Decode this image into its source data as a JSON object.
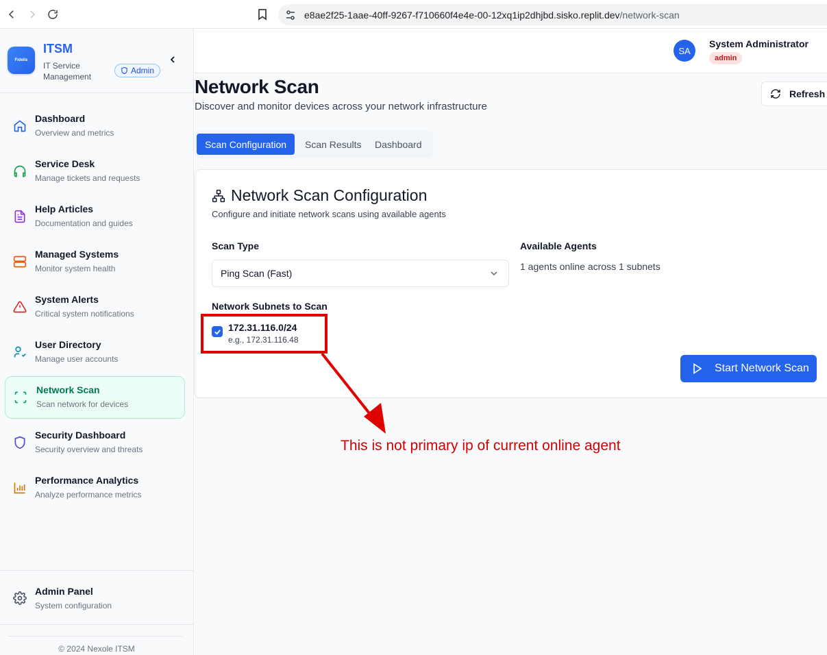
{
  "browser": {
    "url_host": "e8ae2f25-1aae-40ff-9267-f710660f4e4e-00-12xq1ip2dhjbd.sisko.replit.dev",
    "url_path": "/network-scan"
  },
  "brand": {
    "logo_text": "Fidelis",
    "title": "ITSM",
    "subtitle": "IT Service Management",
    "badge": "Admin"
  },
  "menu": [
    {
      "title": "Dashboard",
      "sub": "Overview and metrics",
      "icon": "home-icon",
      "color": "#2563eb"
    },
    {
      "title": "Service Desk",
      "sub": "Manage tickets and requests",
      "icon": "headphones-icon",
      "color": "#16a34a"
    },
    {
      "title": "Help Articles",
      "sub": "Documentation and guides",
      "icon": "file-text-icon",
      "color": "#9333ea"
    },
    {
      "title": "Managed Systems",
      "sub": "Monitor system health",
      "icon": "server-icon",
      "color": "#ea580c"
    },
    {
      "title": "System Alerts",
      "sub": "Critical system notifications",
      "icon": "alert-triangle-icon",
      "color": "#dc2626"
    },
    {
      "title": "User Directory",
      "sub": "Manage user accounts",
      "icon": "user-check-icon",
      "color": "#0891b2"
    },
    {
      "title": "Network Scan",
      "sub": "Scan network for devices",
      "icon": "scan-icon",
      "color": "#059669"
    },
    {
      "title": "Security Dashboard",
      "sub": "Security overview and threats",
      "icon": "shield-icon",
      "color": "#4f46e5"
    },
    {
      "title": "Performance Analytics",
      "sub": "Analyze performance metrics",
      "icon": "bar-chart-icon",
      "color": "#d97706"
    }
  ],
  "admin_panel": {
    "title": "Admin Panel",
    "sub": "System configuration"
  },
  "copyright": "© 2024 Nexole ITSM",
  "user": {
    "initials": "SA",
    "name": "System Administrator",
    "role": "admin"
  },
  "page": {
    "title": "Network Scan",
    "subtitle": "Discover and monitor devices across your network infrastructure",
    "refresh_label": "Refresh"
  },
  "tabs": [
    {
      "label": "Scan Configuration",
      "active": true
    },
    {
      "label": "Scan Results",
      "active": false
    },
    {
      "label": "Dashboard",
      "active": false
    }
  ],
  "config": {
    "title": "Network Scan Configuration",
    "subtitle": "Configure and initiate network scans using available agents",
    "scan_type_label": "Scan Type",
    "scan_type_value": "Ping Scan (Fast)",
    "agents_label": "Available Agents",
    "agents_text": "1 agents online across 1 subnets",
    "subnets_label": "Network Subnets to Scan",
    "subnet": {
      "name": "172.31.116.0/24",
      "example": "e.g., 172.31.116.48",
      "checked": true
    },
    "start_label": "Start Network Scan"
  },
  "annotation": {
    "text": "This is not primary ip of current online agent",
    "color": "#e10000"
  }
}
